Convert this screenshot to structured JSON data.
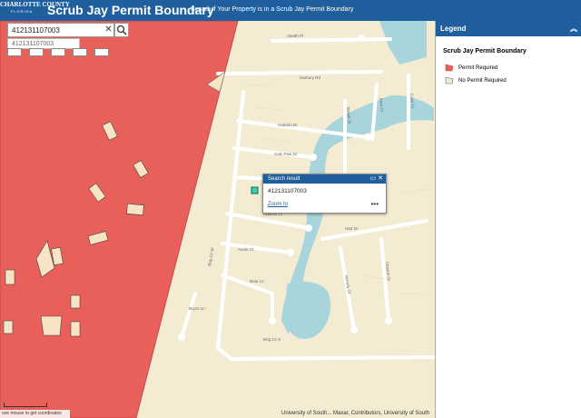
{
  "header": {
    "logo_line1": "CHARLOTTE COUNTY",
    "logo_line2": "FLORIDA",
    "title": "Scrub Jay Permit Boundary",
    "subtitle": "Search if Your Property is in a Scrub Jay Permit Boundary"
  },
  "search": {
    "value": "412131107003",
    "suggestion": "412131107003"
  },
  "legend": {
    "title": "Legend",
    "layer_name": "Scrub Jay Permit Boundary",
    "items": [
      {
        "label": "Permit Required",
        "color": "#e9605b"
      },
      {
        "label": "No Permit Required",
        "color": "#f4ecd2"
      }
    ]
  },
  "popup": {
    "title": "Search result",
    "value": "412131107003",
    "zoom_label": "Zoom to"
  },
  "streets": [
    "Aleath Pl",
    "Harbury Rd",
    "Haddon Dr",
    "Cats Paw Dr",
    "Abacus Ct",
    "Anole Ct",
    "Briar Ln",
    "Bryce Ln",
    "Brig Cir S",
    "Brig Cir W",
    "Hart Dr",
    "Norway Dr",
    "Claxton Dr",
    "Bench St",
    "Fern Ct",
    "Cove Ct"
  ],
  "status": {
    "coords_hint": "ove mouse to get coordinates",
    "attribution": "University of South... Maxar, Contributors, University of South"
  },
  "colors": {
    "header": "#1f5f9e",
    "permit_area": "#e9605b",
    "land": "#f4ecd2",
    "water": "#a8d5dc"
  }
}
